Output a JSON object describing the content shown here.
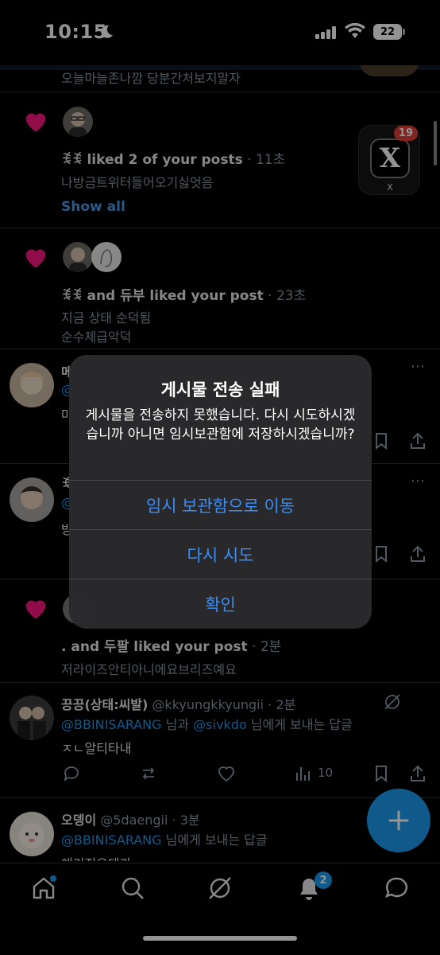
{
  "status_bar": {
    "time": "10:15",
    "battery": "22"
  },
  "feed": {
    "top_text": "오늘마늘존나깜 당분간처보지말자",
    "notif1": {
      "user": "ꉂꉂ",
      "action": " liked 2 of your posts",
      "time": " · 11초",
      "text": "나방금트위터들어오기싫엇음",
      "show_all": "Show all"
    },
    "notif2": {
      "user": "ꉂꉂ",
      "action": " and 듀부 liked your post",
      "time": " · 23초",
      "line1": "지금 상태 순덕됨",
      "line2": "순수체급악덕"
    },
    "post_a": {
      "name": "메",
      "mention": "@",
      "text": "마"
    },
    "post_b": {
      "name": "ꉂ",
      "mention": "@",
      "text": "방"
    },
    "notif3": {
      "user": ".",
      "action": " and 두팔 liked your post",
      "time": " · 2분",
      "text": "저라이즈안티아니에요브리즈예요"
    },
    "reply1": {
      "name": "끙끙(상태:씨발)",
      "handle": " @kkyungkkyungii · 2분",
      "to1": "@BBINISARANG",
      "mid": " 님과 ",
      "to2": "@sivkdo",
      "tail": " 님에게 보내는 답글",
      "text": "ㅈㄴ알티타내",
      "views": "10"
    },
    "reply2": {
      "name": "오뎅이",
      "handle": " @5daengii · 3분",
      "to1": "@BBINISARANG",
      "tail": " 님에게 보내는 답글",
      "text": "애기지오데가"
    }
  },
  "app_switch_badge": {
    "badge": "19",
    "label": "X",
    "glyph": "X"
  },
  "alert": {
    "title": "게시물 전송 실패",
    "message": "게시물을 전송하지 못했습니다. 다시 시도하시겠습니까 아니면 임시보관함에 저장하시겠습니까?",
    "buttons": [
      "임시 보관함으로 이동",
      "다시 시도",
      "확인"
    ]
  },
  "tab_bar": {
    "notification_count": "2",
    "icons": [
      "home-icon",
      "search-icon",
      "grok-icon",
      "bell-icon",
      "messages-icon"
    ]
  },
  "colors": {
    "accent": "#1d9bf0",
    "like": "#f91880",
    "alert_button": "#3b8df6"
  }
}
